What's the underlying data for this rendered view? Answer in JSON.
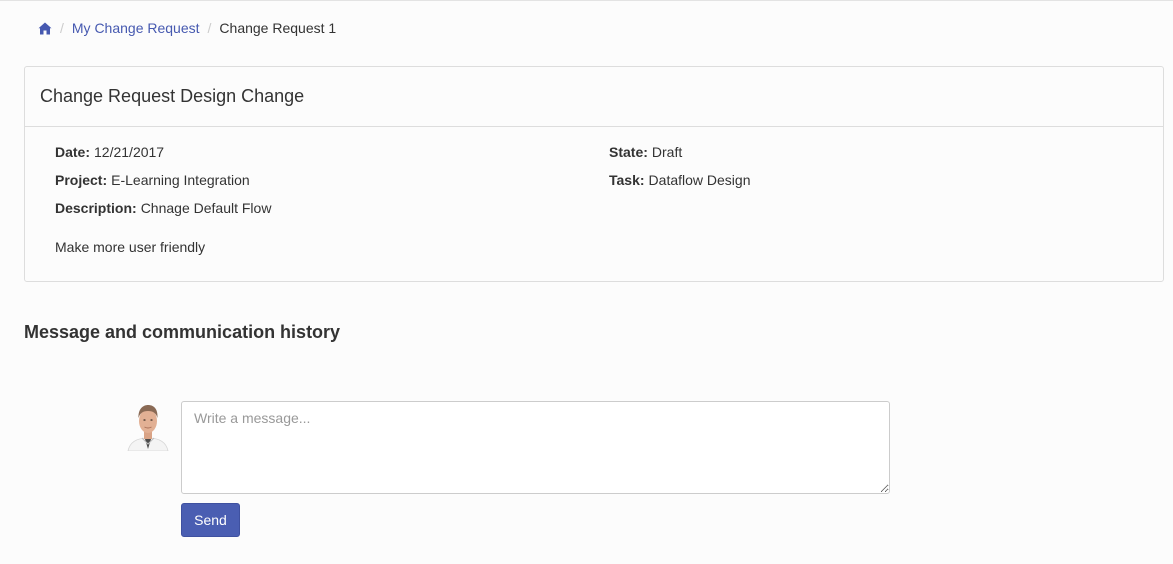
{
  "breadcrumb": {
    "home_icon": "home-icon",
    "items": [
      "My Change Request",
      "Change Request 1"
    ],
    "link_color": "#4659b0"
  },
  "panel": {
    "title": "Change Request Design Change",
    "fields": {
      "date_label": "Date:",
      "date_value": "12/21/2017",
      "project_label": "Project:",
      "project_value": "E-Learning Integration",
      "description_label": "Description:",
      "description_value": "Chnage Default Flow",
      "state_label": "State:",
      "state_value": "Draft",
      "task_label": "Task:",
      "task_value": "Dataflow Design"
    },
    "note": "Make more user friendly"
  },
  "messages": {
    "section_title": "Message and communication history",
    "placeholder": "Write a message...",
    "send_label": "Send",
    "send_color": "#4a5eb2"
  }
}
